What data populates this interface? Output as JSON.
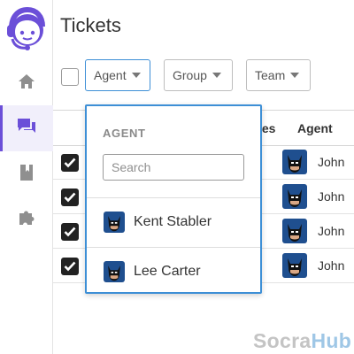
{
  "app": {
    "page_title": "Tickets",
    "accent_color": "#6b4fd8",
    "focus_color": "#3d8fd6"
  },
  "sidebar": {
    "logo_icon": "support-agent-headset-logo",
    "items": [
      {
        "icon": "home-icon",
        "active": false
      },
      {
        "icon": "chat-bubbles-icon",
        "active": true
      },
      {
        "icon": "book-icon",
        "active": false
      },
      {
        "icon": "puzzle-icon",
        "active": false
      }
    ]
  },
  "filters": {
    "agent_label": "Agent",
    "group_label": "Group",
    "team_label": "Team",
    "caret_icon": "caret-down-icon"
  },
  "table": {
    "headers": {
      "properties_partial": "ies",
      "agent": "Agent"
    },
    "rows": [
      {
        "checked": true,
        "agent": "John"
      },
      {
        "checked": true,
        "agent": "John"
      },
      {
        "checked": true,
        "agent": "John"
      },
      {
        "checked": true,
        "agent": "John"
      }
    ]
  },
  "agent_dropdown": {
    "heading": "AGENT",
    "search_placeholder": "Search",
    "options": [
      {
        "name": "Kent Stabler"
      },
      {
        "name": "Lee Carter"
      }
    ]
  },
  "watermark": {
    "part1": "Socra",
    "part2": "Hub"
  }
}
